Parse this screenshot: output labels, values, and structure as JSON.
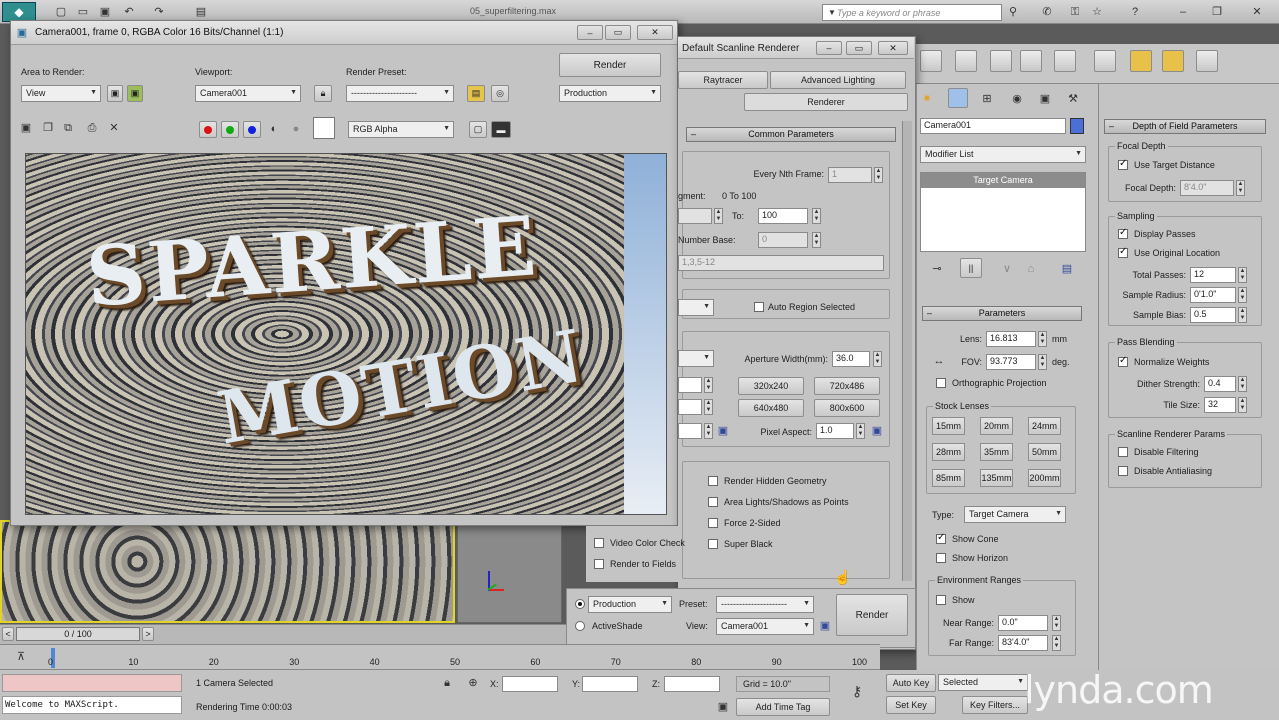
{
  "app": {
    "title": "05_superfiltering.max",
    "search_placeholder": "Type a keyword or phrase"
  },
  "frame_window": {
    "title": "Camera001, frame 0, RGBA Color 16 Bits/Channel (1:1)",
    "area_label": "Area to Render:",
    "area_value": "View",
    "viewport_label": "Viewport:",
    "viewport_value": "Camera001",
    "preset_label": "Render Preset:",
    "preset_value": "----------------------",
    "render_button": "Render",
    "mode_value": "Production",
    "channel_value": "RGB Alpha"
  },
  "render_setup": {
    "title": "Default Scanline Renderer",
    "tabs": [
      "Raytracer",
      "Advanced Lighting",
      "Renderer"
    ],
    "common_rollout": "Common Parameters",
    "every_nth_label": "Every Nth Frame:",
    "every_nth_value": "1",
    "range_text": "0 To 100",
    "range_prefix": "gment:",
    "to_label": "To:",
    "to_value": "100",
    "number_base_label": "Number Base:",
    "number_base_value": "0",
    "frames_value": "1,3,5-12",
    "auto_region": "Auto Region Selected",
    "aperture_label": "Aperture Width(mm):",
    "aperture_value": "36.0",
    "sizes": [
      "320x240",
      "720x486",
      "640x480",
      "800x600"
    ],
    "pixel_aspect_label": "Pixel Aspect:",
    "pixel_aspect_value": "1.0",
    "options": [
      "Render Hidden Geometry",
      "Area Lights/Shadows as Points",
      "Force 2-Sided",
      "Super Black"
    ],
    "options_left": [
      "Video Color Check",
      "Render to Fields"
    ],
    "production_label": "Production",
    "activeshade_label": "ActiveShade",
    "preset_label": "Preset:",
    "preset_value": "----------------------",
    "view_label": "View:",
    "view_value": "Camera001",
    "render_button": "Render"
  },
  "command_panel": {
    "object_name": "Camera001",
    "object_color": "#4a6fd6",
    "modifier_list": "Modifier List",
    "stack_item": "Target Camera",
    "parameters_rollout": "Parameters",
    "lens_label": "Lens:",
    "lens_value": "16.813",
    "lens_unit": "mm",
    "fov_label": "FOV:",
    "fov_value": "93.773",
    "fov_unit": "deg.",
    "ortho_label": "Orthographic Projection",
    "stock_lenses_label": "Stock Lenses",
    "lenses": [
      "15mm",
      "20mm",
      "24mm",
      "28mm",
      "35mm",
      "50mm",
      "85mm",
      "135mm",
      "200mm"
    ],
    "type_label": "Type:",
    "type_value": "Target Camera",
    "show_cone": "Show Cone",
    "show_horizon": "Show Horizon",
    "env_ranges": "Environment Ranges",
    "show": "Show",
    "near_range_label": "Near Range:",
    "near_range_value": "0.0\"",
    "far_range_label": "Far Range:",
    "far_range_value": "83'4.0\""
  },
  "dof_panel": {
    "title": "Depth of Field Parameters",
    "focal_depth_group": "Focal Depth",
    "use_target_distance": "Use Target Distance",
    "focal_depth_label": "Focal Depth:",
    "focal_depth_value": "8'4.0\"",
    "sampling_group": "Sampling",
    "display_passes": "Display Passes",
    "use_original_location": "Use Original Location",
    "total_passes_label": "Total Passes:",
    "total_passes_value": "12",
    "sample_radius_label": "Sample Radius:",
    "sample_radius_value": "0'1.0\"",
    "sample_bias_label": "Sample Bias:",
    "sample_bias_value": "0.5",
    "pass_blending_group": "Pass Blending",
    "normalize_weights": "Normalize Weights",
    "dither_strength_label": "Dither Strength:",
    "dither_strength_value": "0.4",
    "tile_size_label": "Tile Size:",
    "tile_size_value": "32",
    "scanline_group": "Scanline Renderer Params",
    "disable_filtering": "Disable Filtering",
    "disable_antialiasing": "Disable Antialiasing"
  },
  "timeline": {
    "frame_counter": "0 / 100",
    "ticks": [
      "0",
      "10",
      "20",
      "30",
      "40",
      "50",
      "60",
      "70",
      "80",
      "90",
      "100"
    ]
  },
  "status": {
    "maxscript": "Welcome to MAXScript.",
    "selection": "1 Camera Selected",
    "rendering_time": "Rendering Time  0:00:03",
    "x_label": "X:",
    "y_label": "Y:",
    "z_label": "Z:",
    "grid": "Grid = 10.0\"",
    "add_time_tag": "Add Time Tag",
    "auto_key": "Auto Key",
    "selected": "Selected",
    "set_key": "Set Key",
    "key_filters": "Key Filters..."
  },
  "render_image": {
    "line1": "SPARKLE",
    "line2": "MOTION"
  },
  "watermark": "lynda.com"
}
